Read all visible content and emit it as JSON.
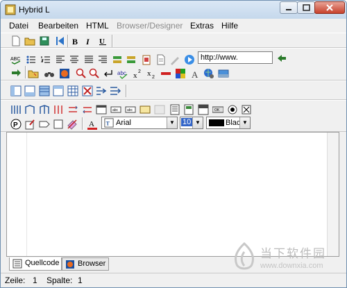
{
  "window": {
    "title": "Hybrid L"
  },
  "menu": [
    "Datei",
    "Bearbeiten",
    "HTML",
    "Browser/Designer",
    "Extras",
    "Hilfe"
  ],
  "url_input": {
    "value": "http://www."
  },
  "font": {
    "name": "Arial",
    "size": "10",
    "color_name": "Black"
  },
  "tabs": [
    "Quellcode",
    "Browser"
  ],
  "status": {
    "line_label": "Zeile:",
    "line_value": "1",
    "col_label": "Spalte:",
    "col_value": "1"
  },
  "watermark": {
    "text": "当下软件园",
    "url": "www.downxia.com"
  },
  "colors": {
    "titlebar": "#c5d8ec",
    "close": "#c7412c",
    "toolbar_bg": "#f0f0f0"
  }
}
